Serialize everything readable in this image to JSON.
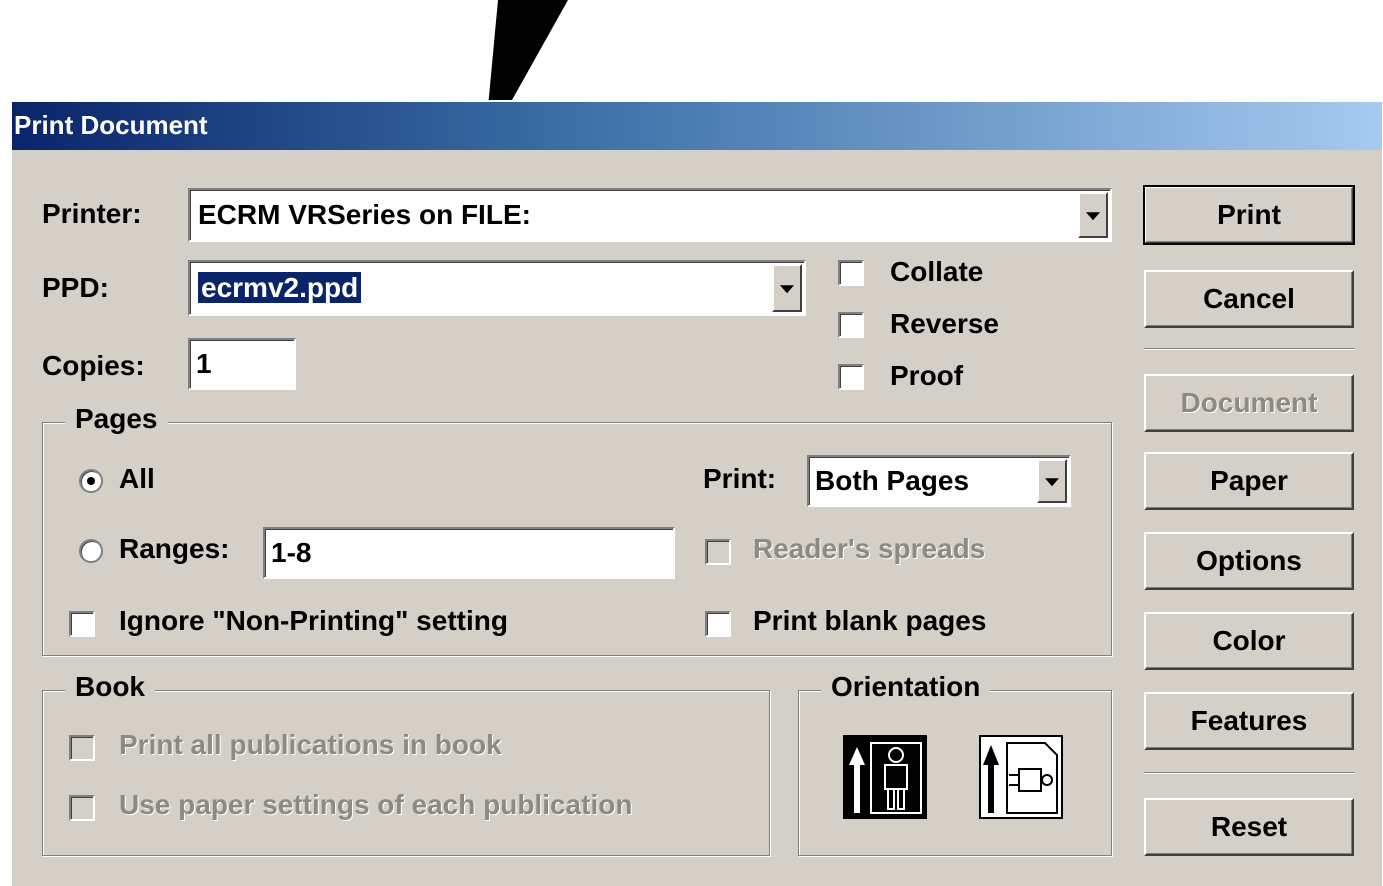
{
  "dialog": {
    "title": "Print Document"
  },
  "printer": {
    "label": "Printer:",
    "value": "ECRM VRSeries on FILE:"
  },
  "ppd": {
    "label": "PPD:",
    "value": "ecrmv2.ppd"
  },
  "copies": {
    "label": "Copies:",
    "value": "1"
  },
  "options_checks": {
    "collate": "Collate",
    "reverse": "Reverse",
    "proof": "Proof"
  },
  "pages": {
    "title": "Pages",
    "all_label": "All",
    "ranges_label": "Ranges:",
    "ranges_value": "1-8",
    "print_label": "Print:",
    "print_value": "Both Pages",
    "readers_spreads": "Reader's spreads",
    "ignore_non_printing": "Ignore \"Non-Printing\" setting",
    "print_blank_pages": "Print blank pages",
    "selected_option": "All"
  },
  "book": {
    "title": "Book",
    "print_all": "Print all publications in book",
    "use_paper_settings": "Use paper settings of each publication"
  },
  "orientation": {
    "title": "Orientation",
    "selected": "portrait"
  },
  "buttons": {
    "print": "Print",
    "cancel": "Cancel",
    "document": "Document",
    "paper": "Paper",
    "options": "Options",
    "color": "Color",
    "features": "Features",
    "reset": "Reset"
  },
  "colors": {
    "dialog_bg": "#d4d0c8",
    "title_gradient_start": "#0a246a",
    "title_gradient_end": "#a6caf0",
    "selection": "#0a246a",
    "disabled_text": "#8e8a82"
  },
  "icons": {
    "pointer": "pointer-arrow-icon",
    "portrait": "portrait-orientation-icon",
    "landscape": "landscape-orientation-icon",
    "dropdown": "chevron-down-icon"
  }
}
